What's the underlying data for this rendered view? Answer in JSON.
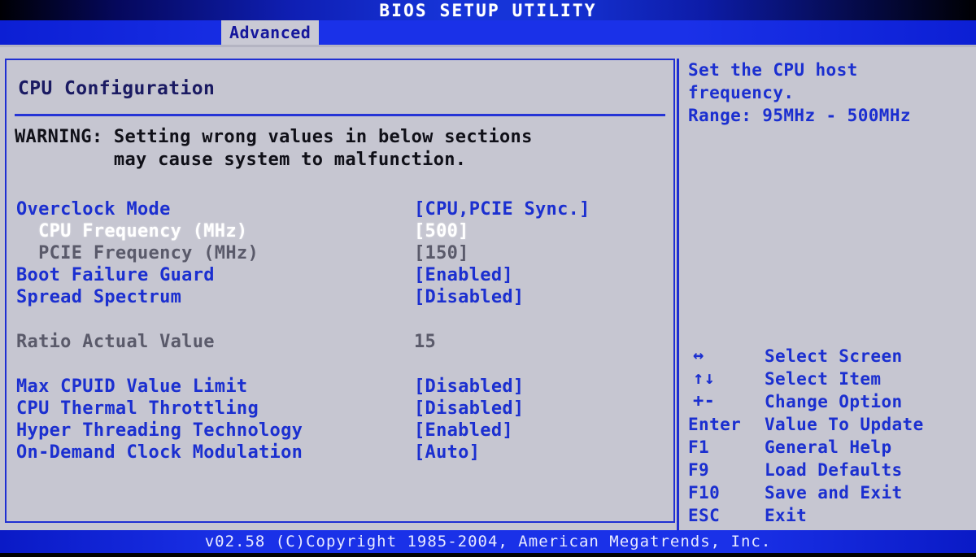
{
  "header": {
    "title": "BIOS SETUP UTILITY",
    "tabs": [
      {
        "label": "Advanced",
        "active": true
      }
    ]
  },
  "main": {
    "section_title": "CPU Configuration",
    "warning_line1": "WARNING: Setting wrong values in below sections",
    "warning_line2": "         may cause system to malfunction.",
    "settings": [
      {
        "label": "Overclock Mode",
        "value": "[CPU,PCIE Sync.]",
        "state": "normal"
      },
      {
        "label": "  CPU Frequency (MHz)",
        "value": "[500]",
        "state": "selected"
      },
      {
        "label": "  PCIE Frequency (MHz)",
        "value": "[150]",
        "state": "disabled"
      },
      {
        "label": "Boot Failure Guard",
        "value": "[Enabled]",
        "state": "normal"
      },
      {
        "label": "Spread Spectrum",
        "value": "[Disabled]",
        "state": "normal"
      },
      {
        "label": "Ratio Actual Value",
        "value": "15",
        "state": "readonly"
      },
      {
        "label": "Max CPUID Value Limit",
        "value": "[Disabled]",
        "state": "normal"
      },
      {
        "label": "CPU Thermal Throttling",
        "value": "[Disabled]",
        "state": "normal"
      },
      {
        "label": "Hyper Threading Technology",
        "value": "[Enabled]",
        "state": "normal"
      },
      {
        "label": "On-Demand Clock Modulation",
        "value": "[Auto]",
        "state": "normal"
      }
    ]
  },
  "help": {
    "lines": [
      "Set the CPU host",
      "frequency.",
      "Range: 95MHz - 500MHz"
    ]
  },
  "key_legend": [
    {
      "key": "↔",
      "desc": "Select Screen",
      "icon": "left-right-arrow-icon"
    },
    {
      "key": "↑↓",
      "desc": "Select Item",
      "icon": "up-down-arrow-icon"
    },
    {
      "key": "+-",
      "desc": "Change Option",
      "icon": "plus-minus-icon"
    },
    {
      "key": "Enter",
      "desc": "Value To Update",
      "icon": "enter-key-icon"
    },
    {
      "key": "F1",
      "desc": "General Help",
      "icon": "f1-key-icon"
    },
    {
      "key": "F9",
      "desc": "Load Defaults",
      "icon": "f9-key-icon"
    },
    {
      "key": "F10",
      "desc": "Save and Exit",
      "icon": "f10-key-icon"
    },
    {
      "key": "ESC",
      "desc": "Exit",
      "icon": "esc-key-icon"
    }
  ],
  "footer": {
    "text": "v02.58 (C)Copyright 1985-2004, American Megatrends, Inc."
  },
  "colors": {
    "background": "#c6c6d1",
    "accent_blue": "#1b2fd0",
    "header_blue": "#1a31e8",
    "selected_text": "#ffffff",
    "disabled_text": "#5a5a6a",
    "warning_text": "#101018"
  }
}
